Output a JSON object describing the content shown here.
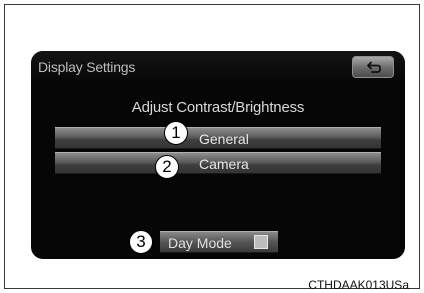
{
  "screen": {
    "title": "Display Settings",
    "back_icon": "return-arrow-icon",
    "subtitle": "Adjust Contrast/Brightness",
    "buttons": [
      {
        "label": "General",
        "callout": "1"
      },
      {
        "label": "Camera",
        "callout": "2"
      }
    ],
    "mode_toggle": {
      "label": "Day Mode",
      "callout": "3",
      "indicator_on": false
    }
  },
  "figure_code": "CTHDAAK013USa",
  "colors": {
    "screen_bg": "#060606",
    "button_gradient_top": "#8d8d8d",
    "button_gradient_bottom": "#343434",
    "text": "#e8e8e8"
  }
}
